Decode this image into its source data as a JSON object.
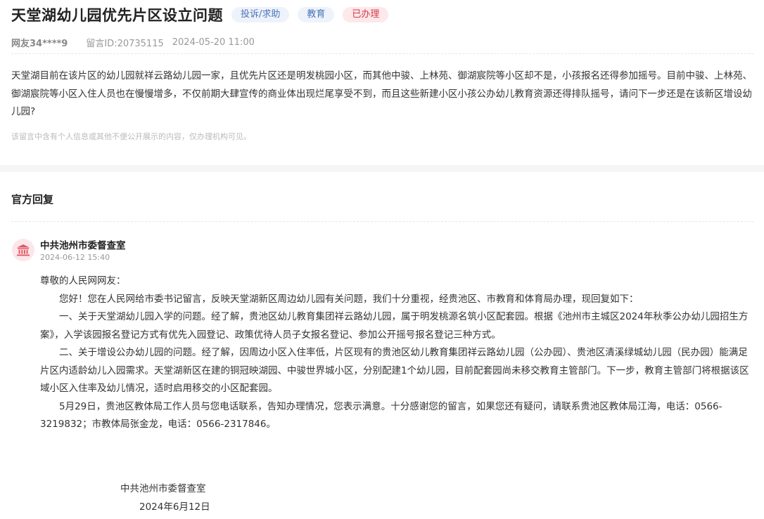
{
  "header": {
    "title": "天堂湖幼儿园优先片区设立问题",
    "tags": [
      "投诉/求助",
      "教育",
      "已办理"
    ]
  },
  "meta": {
    "user": "网友34****9",
    "message_id": "留言ID:20735115",
    "datetime": "2024-05-20 11:00"
  },
  "question": {
    "text": "天堂湖目前在该片区的幼儿园就祥云路幼儿园一家，且优先片区还是明发桃园小区，而其他中骏、上林苑、御湖宸院等小区却不是，小孩报名还得参加摇号。目前中骏、上林苑、御湖宸院等小区入住人员也在慢慢增多，不仅前期大肆宣传的商业体出现烂尾享受不到，而且这些新建小区小孩公办幼儿教育资源还得排队摇号，请问下一步还是在该新区增设幼儿园?",
    "privacy_note": "该留言中含有个人信息或其他不便公开展示的内容，仅办理机构可见。"
  },
  "reply_section": {
    "title": "官方回复",
    "org_icon": "government-building-icon",
    "org_name": "中共池州市委督查室",
    "date": "2024-06-12 15:40",
    "greeting": "尊敬的人民网网友：",
    "paragraphs": [
      "您好！您在人民网给市委书记留言，反映天堂湖新区周边幼儿园有关问题，我们十分重视，经贵池区、市教育和体育局办理，现回复如下：",
      "一、关于天堂湖幼儿园入学的问题。经了解，贵池区幼儿教育集团祥云路幼儿园，属于明发桃源名筑小区配套园。根据《池州市主城区2024年秋季公办幼儿园招生方案》，入学该园报名登记方式有优先入园登记、政策优待人员子女报名登记、参加公开摇号报名登记三种方式。",
      "二、关于增设公办幼儿园的问题。经了解，因周边小区入住率低，片区现有的贵池区幼儿教育集团祥云路幼儿园（公办园）、贵池区清溪绿城幼儿园（民办园）能满足片区内适龄幼儿入园需求。天堂湖新区在建的铜冠映湖园、中骏世界城小区，分别配建1个幼儿园，目前配套园尚未移交教育主管部门。下一步，教育主管部门将根据该区域小区入住率及幼儿情况，适时启用移交的小区配套园。",
      "5月29日，贵池区教体局工作人员与您电话联系，告知办理情况，您表示满意。十分感谢您的留言，如果您还有疑问，请联系贵池区教体局江海，电话：0566-3219832；市教体局张金龙，电话：0566-2317846。"
    ],
    "signature_org": "中共池州市委督查室",
    "signature_date": "2024年6月12日"
  },
  "colors": {
    "tag_blue_text": "#4a74b8",
    "tag_blue_bg": "#eef3fb",
    "tag_red_text": "#d43a48",
    "tag_red_bg": "#fde8ea",
    "icon_bg": "#fbe7e9",
    "icon_fg": "#e25563"
  }
}
